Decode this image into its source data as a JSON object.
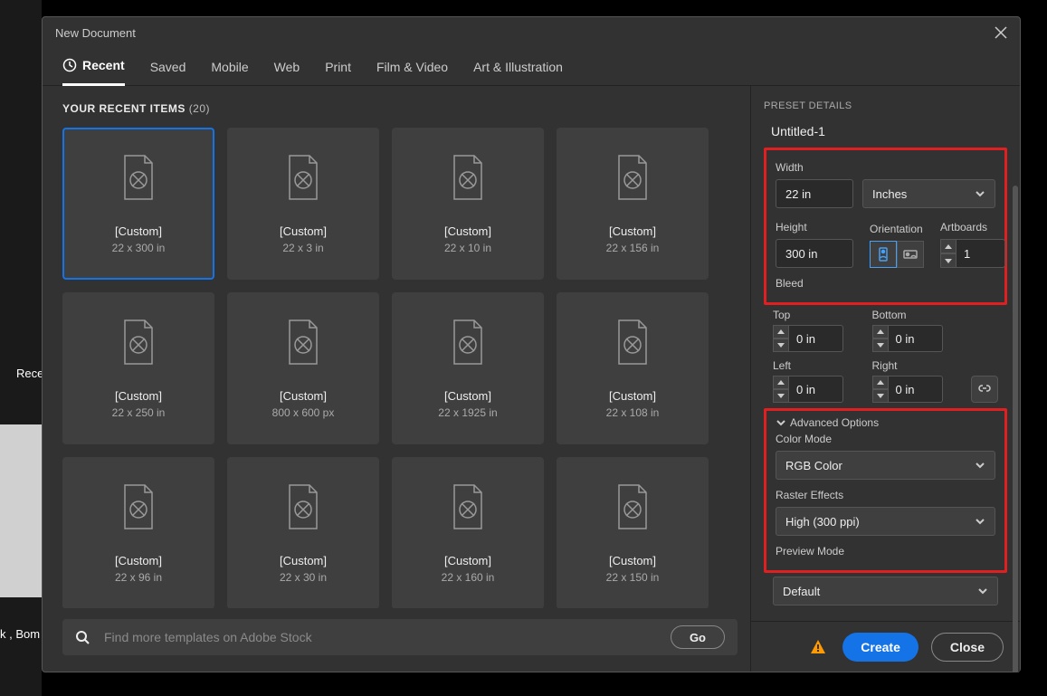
{
  "backdrop": {
    "text1": "Rece",
    "text2": "k , Bom"
  },
  "dialog": {
    "title": "New Document",
    "tabs": [
      "Recent",
      "Saved",
      "Mobile",
      "Web",
      "Print",
      "Film & Video",
      "Art & Illustration"
    ],
    "active_tab": 0
  },
  "recent": {
    "heading": "YOUR RECENT ITEMS",
    "count": "(20)",
    "items": [
      {
        "title": "[Custom]",
        "sub": "22 x 300 in",
        "selected": true
      },
      {
        "title": "[Custom]",
        "sub": "22 x 3 in"
      },
      {
        "title": "[Custom]",
        "sub": "22 x 10 in"
      },
      {
        "title": "[Custom]",
        "sub": "22 x 156 in"
      },
      {
        "title": "[Custom]",
        "sub": "22 x 250 in"
      },
      {
        "title": "[Custom]",
        "sub": "800 x 600 px"
      },
      {
        "title": "[Custom]",
        "sub": "22 x 1925 in"
      },
      {
        "title": "[Custom]",
        "sub": "22 x 108 in"
      },
      {
        "title": "[Custom]",
        "sub": "22 x 96 in"
      },
      {
        "title": "[Custom]",
        "sub": "22 x 30 in"
      },
      {
        "title": "[Custom]",
        "sub": "22 x 160 in"
      },
      {
        "title": "[Custom]",
        "sub": "22 x 150 in"
      }
    ]
  },
  "search": {
    "placeholder": "Find more templates on Adobe Stock",
    "go": "Go"
  },
  "preset": {
    "heading": "PRESET DETAILS",
    "name": "Untitled-1",
    "width_label": "Width",
    "width": "22 in",
    "units": "Inches",
    "height_label": "Height",
    "height": "300 in",
    "orientation_label": "Orientation",
    "artboards_label": "Artboards",
    "artboards": "1",
    "bleed_label": "Bleed",
    "top_label": "Top",
    "top": "0 in",
    "bottom_label": "Bottom",
    "bottom": "0 in",
    "left_label": "Left",
    "left": "0 in",
    "right_label": "Right",
    "right": "0 in",
    "advanced_label": "Advanced Options",
    "colormode_label": "Color Mode",
    "colormode": "RGB Color",
    "raster_label": "Raster Effects",
    "raster": "High (300 ppi)",
    "preview_label": "Preview Mode",
    "preview": "Default"
  },
  "footer": {
    "create": "Create",
    "close": "Close"
  }
}
